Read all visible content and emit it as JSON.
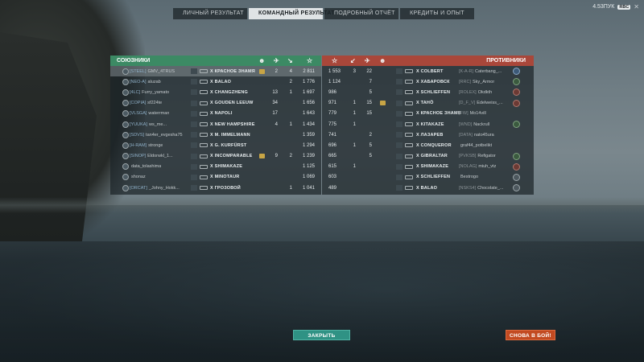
{
  "tabs": [
    {
      "label": "ЛИЧНЫЙ РЕЗУЛЬТАТ",
      "active": false
    },
    {
      "label": "КОМАНДНЫЙ РЕЗУЛЬТАТ",
      "active": true
    },
    {
      "label": "ПОДРОБНЫЙ ОТЧЁТ",
      "active": false
    },
    {
      "label": "КРЕДИТЫ И ОПЫТ",
      "active": false
    }
  ],
  "account": {
    "tag": "RBC",
    "name": "4.53ПУК"
  },
  "allies": {
    "title": "СОЮЗНИКИ",
    "rows": [
      {
        "clan": "[STEEL]",
        "player": "GMV_4TRUS",
        "tier": "X",
        "ship": "X КРАСНОЕ ЗНАМЯ",
        "medal": true,
        "planes": "2",
        "kills": "4",
        "xp": "2 811",
        "me": true
      },
      {
        "clan": "[NEO-A]",
        "player": "aluzab",
        "tier": "X",
        "ship": "X BALAO",
        "medal": false,
        "planes": "",
        "kills": "2",
        "xp": "1 776"
      },
      {
        "clan": "[4LC]",
        "player": "Furry_yamato",
        "tier": "X",
        "ship": "X CHANGZHENG",
        "medal": false,
        "planes": "13",
        "kills": "1",
        "xp": "1 697"
      },
      {
        "clan": "[COPIA]",
        "player": "sf224te",
        "tier": "X",
        "ship": "X GOUDEN LEEUW",
        "medal": false,
        "planes": "34",
        "kills": "",
        "xp": "1 656"
      },
      {
        "clan": "[VLSGA]",
        "player": "waterrman",
        "tier": "X",
        "ship": "X NAPOLI",
        "medal": false,
        "planes": "17",
        "kills": "",
        "xp": "1 643"
      },
      {
        "clan": "[YUUKA]",
        "player": "ws_me...",
        "tier": "X",
        "ship": "X NEW HAMPSHIRE",
        "medal": false,
        "planes": "4",
        "kills": "1",
        "xp": "1 434"
      },
      {
        "clan": "[SDVS]",
        "player": "tan4er_evgesha75",
        "tier": "X",
        "ship": "X M. IMMELMANN",
        "medal": false,
        "planes": "",
        "kills": "",
        "xp": "1 359"
      },
      {
        "clan": "[H-RAM]",
        "player": "stronge",
        "tier": "X",
        "ship": "X G. KURFÜRST",
        "medal": false,
        "planes": "",
        "kills": "",
        "xp": "1 294"
      },
      {
        "clan": "[SINOP]",
        "player": "Eldorwkl_1...",
        "tier": "X",
        "ship": "X INCOMPARABLE",
        "medal": true,
        "planes": "9",
        "kills": "2",
        "xp": "1 239"
      },
      {
        "clan": "",
        "player": "data_tolashima",
        "tier": "X",
        "ship": "X SHIMAKAZE",
        "medal": false,
        "planes": "",
        "kills": "",
        "xp": "1 125"
      },
      {
        "clan": "",
        "player": "shonaz",
        "tier": "X",
        "ship": "X MINOTAUR",
        "medal": false,
        "planes": "",
        "kills": "",
        "xp": "1 069"
      },
      {
        "clan": "[ORCAT]",
        "player": "_Johny_Hokk...",
        "tier": "X",
        "ship": "X ГРОЗОВОЙ",
        "medal": false,
        "planes": "",
        "kills": "1",
        "xp": "1 041"
      }
    ]
  },
  "enemies": {
    "title": "ПРОТИВНИКИ",
    "rows": [
      {
        "xp": "1 553",
        "kills": "3",
        "planes": "22",
        "medal": false,
        "ship": "X COLBERT",
        "clan": "[K-A-R]",
        "player": "Caterbang_...",
        "emblem": "blue"
      },
      {
        "xp": "1 124",
        "kills": "",
        "planes": "7",
        "medal": false,
        "ship": "X ХАБАРОВСК",
        "clan": "[RRC]",
        "player": "Sky_Armor",
        "emblem": "green"
      },
      {
        "xp": "986",
        "kills": "",
        "planes": "5",
        "medal": false,
        "ship": "X SCHLIEFFEN",
        "clan": "[ROLEX]",
        "player": "Okdkth",
        "emblem": "red"
      },
      {
        "xp": "971",
        "kills": "1",
        "planes": "15",
        "medal": true,
        "ship": "X TAHÖ",
        "clan": "[D_F_V]",
        "player": "Edelweiss_...",
        "emblem": "red"
      },
      {
        "xp": "779",
        "kills": "1",
        "planes": "15",
        "medal": false,
        "ship": "X КРАСНОЕ ЗНАМЯ",
        "clan": "[FW]",
        "player": "Mo14vill",
        "emblem": ""
      },
      {
        "xp": "775",
        "kills": "1",
        "planes": "",
        "medal": false,
        "ship": "X KITAKAZE",
        "clan": "[WND]",
        "player": "Nackrull",
        "emblem": "green"
      },
      {
        "xp": "741",
        "kills": "",
        "planes": "2",
        "medal": false,
        "ship": "X ЛАЗАРЕВ",
        "clan": "[DATA]",
        "player": "nato45ura",
        "emblem": ""
      },
      {
        "xp": "696",
        "kills": "1",
        "planes": "5",
        "medal": false,
        "ship": "X CONQUEROR",
        "clan": "",
        "player": "graf44_potbelikt",
        "emblem": ""
      },
      {
        "xp": "665",
        "kills": "",
        "planes": "5",
        "medal": false,
        "ship": "X GIBRALTAR",
        "clan": "[PVKSB]",
        "player": "Refigator",
        "emblem": "green"
      },
      {
        "xp": "615",
        "kills": "1",
        "planes": "",
        "medal": false,
        "ship": "X SHIMAKAZE",
        "clan": "[NOLAG]",
        "player": "miuh_vtz",
        "emblem": "red"
      },
      {
        "xp": "603",
        "kills": "",
        "planes": "",
        "medal": false,
        "ship": "X SCHLIEFFEN",
        "clan": "",
        "player": "Bestrogo",
        "emblem": "grey"
      },
      {
        "xp": "489",
        "kills": "",
        "planes": "",
        "medal": false,
        "ship": "X BALAO",
        "clan": "[NSKS4]",
        "player": "Chocolate_...",
        "emblem": "grey"
      }
    ]
  },
  "buttons": {
    "close": "ЗАКРЫТЬ",
    "again": "СНОВА В БОЙ!"
  },
  "colors": {
    "ally_header": "#3c8a64",
    "enemy_header": "#a9473a",
    "close_btn": "#2f9284",
    "again_btn": "#c24a21"
  },
  "icons": {
    "medal": "medal-icon",
    "planes": "plane-icon",
    "kills": "kill-icon",
    "xp": "star-icon"
  }
}
